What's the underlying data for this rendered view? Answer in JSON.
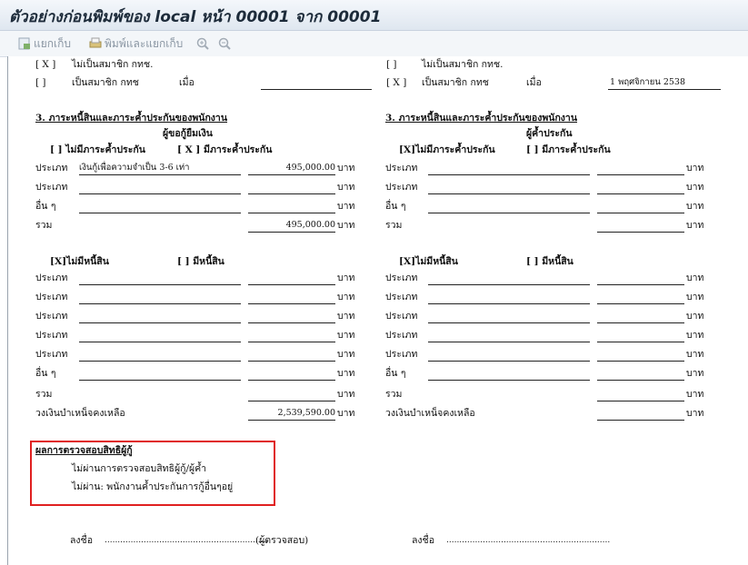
{
  "window": {
    "title": "ตัวอย่างก่อนพิมพ์ของ local หน้า 00001 จาก 00001"
  },
  "toolbar": {
    "split_label": "แยกเก็บ",
    "print_split_label": "พิมพ์และแยกเก็บ"
  },
  "top": {
    "left": {
      "r1": {
        "box": "[ X ]",
        "text": "ไม่เป็นสมาชิก กทช."
      },
      "r2": {
        "box": "[ ]",
        "text": "เป็นสมาชิก กทช",
        "when": "เมื่อ",
        "date": ""
      }
    },
    "right": {
      "r1": {
        "box": "[ ]",
        "text": "ไม่เป็นสมาชิก กทช."
      },
      "r2": {
        "box": "[ X ]",
        "text": "เป็นสมาชิก กทช",
        "when": "เมื่อ",
        "date": "1     พฤศจิกายน 2538"
      }
    }
  },
  "left": {
    "heading": "3. ภาระหนี้สินและภาระค้ำประกันของพนักงาน",
    "sub": "ผู้ขอกู้ยืมเงิน",
    "guar_none": "[ ]  ไม่มีภาระค้ำประกัน",
    "guar_has": "[ X ]    มีภาระค้ำประกัน",
    "rows": [
      {
        "label": "ประเภท",
        "desc": "เงินกู้เพื่อความจำเป็น 3-6      เท่า",
        "value": "495,000.00",
        "unit": "บาท"
      },
      {
        "label": "ประเภท",
        "desc": "",
        "value": "",
        "unit": "บาท"
      },
      {
        "label": "อื่น ๆ",
        "desc": "",
        "value": "",
        "unit": "บาท"
      },
      {
        "label": "รวม",
        "value": "495,000.00",
        "unit": "บาท"
      }
    ],
    "debt_none": "[X]ไม่มีหนี้สิน",
    "debt_has": "[ ]      มีหนี้สิน",
    "debt_rows": [
      {
        "label": "ประเภท",
        "value": "",
        "unit": "บาท"
      },
      {
        "label": "ประเภท",
        "value": "",
        "unit": "บาท"
      },
      {
        "label": "ประเภท",
        "value": "",
        "unit": "บาท"
      },
      {
        "label": "ประเภท",
        "value": "",
        "unit": "บาท"
      },
      {
        "label": "ประเภท",
        "value": "",
        "unit": "บาท"
      },
      {
        "label": "อื่น ๆ",
        "value": "",
        "unit": "บาท"
      },
      {
        "label": "รวม",
        "value": "",
        "unit": "บาท"
      },
      {
        "label": "วงเงินบำเหน็จคงเหลือ",
        "value": "2,539,590.00",
        "unit": "บาท"
      }
    ]
  },
  "right": {
    "heading": "3. ภาระหนี้สินและภาระค้ำประกันของพนักงาน",
    "sub": "ผู้ค้ำประกัน",
    "guar_none": "[X]ไม่มีภาระค้ำประกัน",
    "guar_has": "[ ]      มีภาระค้ำประกัน",
    "rows": [
      {
        "label": "ประเภท",
        "value": "",
        "unit": "บาท"
      },
      {
        "label": "ประเภท",
        "value": "",
        "unit": "บาท"
      },
      {
        "label": "อื่น ๆ",
        "value": "",
        "unit": "บาท"
      },
      {
        "label": "รวม",
        "value": "",
        "unit": "บาท"
      }
    ],
    "debt_none": "[X]ไม่มีหนี้สิน",
    "debt_has": "[ ]      มีหนี้สิน",
    "debt_rows": [
      {
        "label": "ประเภท",
        "value": "",
        "unit": "บาท"
      },
      {
        "label": "ประเภท",
        "value": "",
        "unit": "บาท"
      },
      {
        "label": "ประเภท",
        "value": "",
        "unit": "บาท"
      },
      {
        "label": "ประเภท",
        "value": "",
        "unit": "บาท"
      },
      {
        "label": "ประเภท",
        "value": "",
        "unit": "บาท"
      },
      {
        "label": "อื่น ๆ",
        "value": "",
        "unit": "บาท"
      },
      {
        "label": "รวม",
        "value": "",
        "unit": "บาท"
      },
      {
        "label": "วงเงินบำเหน็จคงเหลือ",
        "value": "",
        "unit": "บาท"
      }
    ]
  },
  "check": {
    "title": "ผลการตรวจสอบสิทธิผู้กู้",
    "line1": "ไม่ผ่านการตรวจสอบสิทธิผู้กู้/ผู้ค้ำ",
    "line2": "ไม่ผ่าน: พนักงานค้ำประกันการกู้อื่นๆอยู่"
  },
  "sign": {
    "left_label": "ลงชื่อ",
    "left_dots": "...............................................................",
    "left_role": "(ผู้ตรวจสอบ)",
    "right_label": "ลงชื่อ",
    "right_dots": "..............................................................."
  }
}
